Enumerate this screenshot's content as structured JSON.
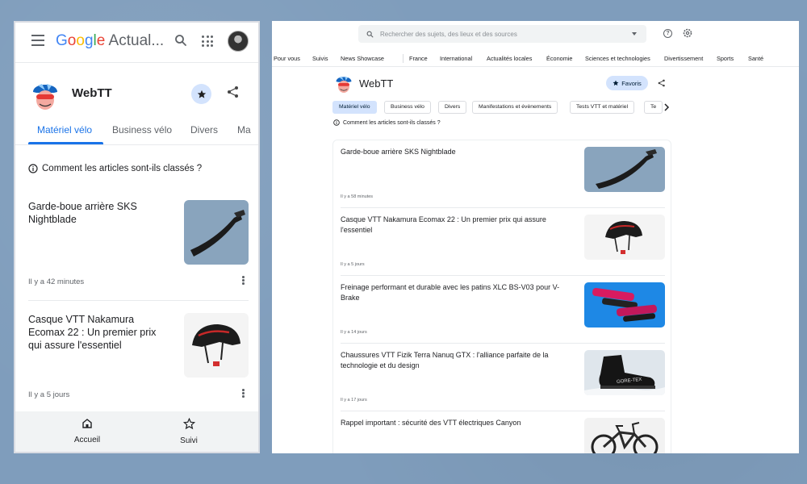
{
  "mobile": {
    "header": {
      "logo_text": "Google Actual..."
    },
    "publisher": {
      "name": "WebTT"
    },
    "tabs": [
      {
        "label": "Matériel vélo"
      },
      {
        "label": "Business vélo"
      },
      {
        "label": "Divers"
      },
      {
        "label": "Ma"
      }
    ],
    "how_ranked": "Comment les articles sont-ils classés ?",
    "articles": [
      {
        "title": "Garde-boue arrière SKS Nightblade",
        "time": "Il y a 42 minutes"
      },
      {
        "title": "Casque VTT Nakamura Ecomax 22 : Un premier prix qui assure l'essentiel",
        "time": "Il y a 5 jours"
      }
    ],
    "bottom_nav": {
      "home": "Accueil",
      "following": "Suivi"
    }
  },
  "desktop": {
    "search": {
      "placeholder": "Rechercher des sujets, des lieux et des sources"
    },
    "nav": [
      "Pour vous",
      "Suivis",
      "News Showcase",
      "France",
      "International",
      "Actualités locales",
      "Économie",
      "Sciences et technologies",
      "Divertissement",
      "Sports",
      "Santé"
    ],
    "publisher": {
      "name": "WebTT",
      "favorite_label": "Favoris"
    },
    "chips": [
      "Matériel vélo",
      "Business vélo",
      "Divers",
      "Manifestations et évènements",
      "Tests VTT et matériel",
      "Te"
    ],
    "how_ranked": "Comment les articles sont-ils classés ?",
    "articles": [
      {
        "title": "Garde-boue arrière SKS Nightblade",
        "time": "Il y a 58 minutes"
      },
      {
        "title": "Casque VTT Nakamura Ecomax 22 : Un premier prix qui assure l'essentiel",
        "time": "Il y a 5 jours"
      },
      {
        "title": "Freinage performant et durable avec les patins XLC BS-V03 pour V-Brake",
        "time": "Il y a 14 jours"
      },
      {
        "title": "Chaussures VTT Fizik Terra Nanuq GTX : l'alliance parfaite de la technologie et du design",
        "time": "Il y a 17 jours"
      },
      {
        "title": "Rappel important : sécurité des VTT électriques Canyon",
        "time": ""
      }
    ],
    "image_labels": {
      "shoe_brand": "GORE-TEX"
    }
  },
  "colors": {
    "accent": "#1a73e8",
    "chip_active": "#d3e3fd",
    "background": "#7f9dbc"
  }
}
